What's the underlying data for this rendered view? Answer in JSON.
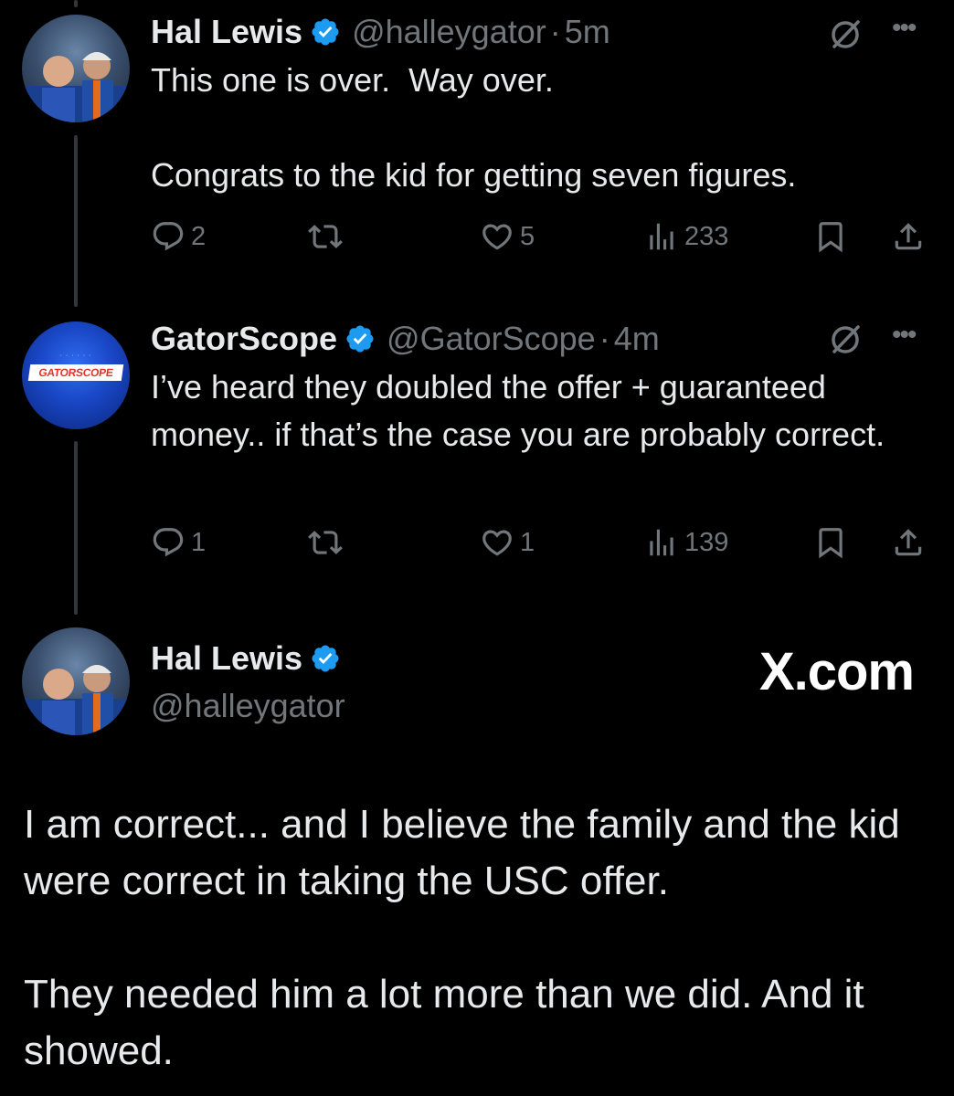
{
  "tweets": [
    {
      "name": "Hal Lewis",
      "handle": "@halleygator",
      "sep": "·",
      "time": "5m",
      "text": "This one is over.  Way over.\n\nCongrats to the kid for getting seven figures.",
      "replies": "2",
      "retweets": "",
      "likes": "5",
      "views": "233"
    },
    {
      "name": "GatorScope",
      "handle": "@GatorScope",
      "sep": "·",
      "time": "4m",
      "text": "I’ve heard they doubled the offer + guaranteed money.. if that’s the case you are probably correct.",
      "replies": "1",
      "retweets": "",
      "likes": "1",
      "views": "139",
      "avatar_text": "GATORSCOPE"
    }
  ],
  "main_tweet": {
    "name": "Hal Lewis",
    "handle": "@halleygator",
    "paragraph1": "I am correct... and I believe the family and the kid were correct in taking the USC offer.",
    "paragraph2": "They needed him a lot more than we did.  And it showed."
  },
  "watermark": "X.com",
  "colors": {
    "background": "#000000",
    "text": "#e7e9ea",
    "muted": "#71767b",
    "verified": "#1d9bf0"
  },
  "icons": [
    "verified-badge-icon",
    "grok-icon",
    "more-icon",
    "reply-icon",
    "retweet-icon",
    "like-icon",
    "views-icon",
    "bookmark-icon",
    "share-icon"
  ]
}
